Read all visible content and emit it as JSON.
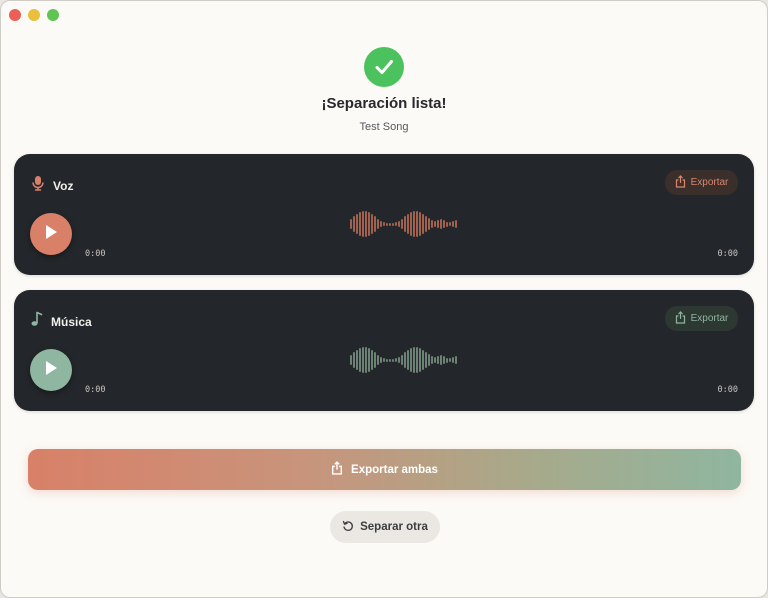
{
  "status": {
    "title": "¡Separación lista!",
    "song_name": "Test Song"
  },
  "tracks": [
    {
      "label": "Voz",
      "icon": "microphone-icon",
      "accent": "#d98068",
      "export_label": "Exportar",
      "current_time": "0:00",
      "duration": "0:00"
    },
    {
      "label": "Música",
      "icon": "music-note-icon",
      "accent": "#8fb6a0",
      "export_label": "Exportar",
      "current_time": "0:00",
      "duration": "0:00"
    }
  ],
  "actions": {
    "export_both": "Exportar ambas",
    "separate_another": "Separar otra"
  },
  "colors": {
    "success": "#4bc25e",
    "card_bg": "#23262a",
    "window_bg": "#fcfaf6"
  }
}
